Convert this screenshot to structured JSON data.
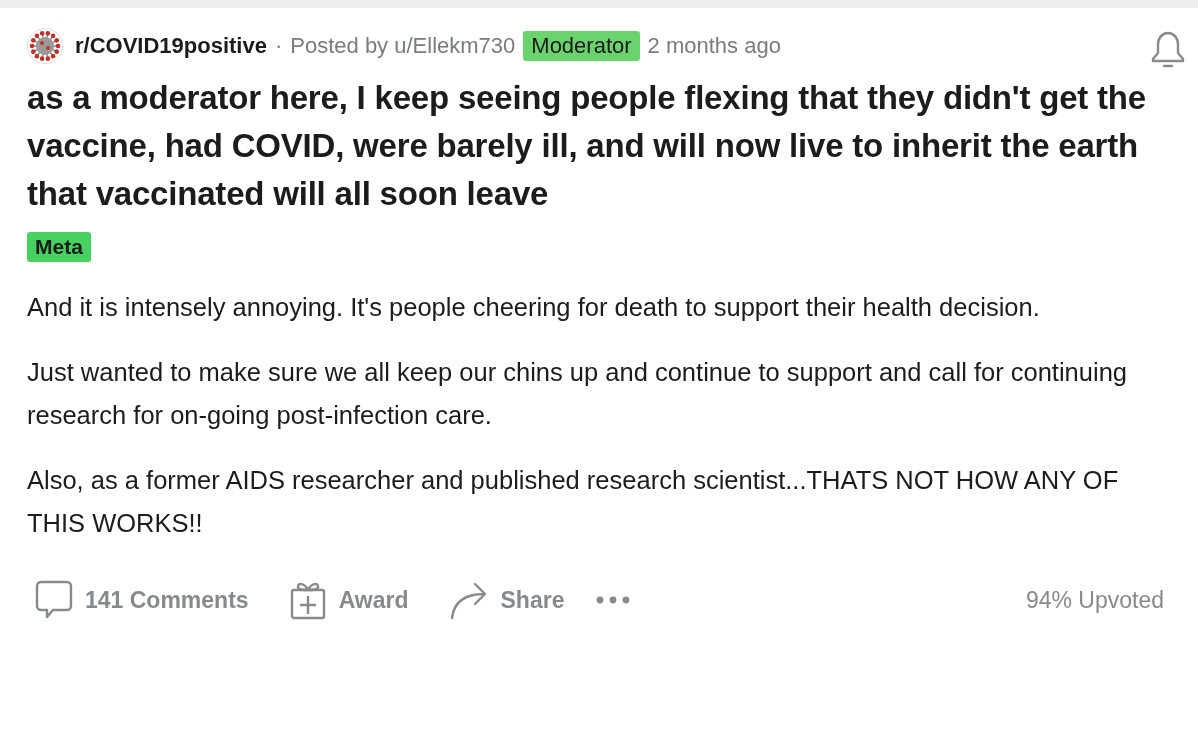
{
  "post": {
    "subreddit": "r/COVID19positive",
    "separator": "·",
    "posted_by": "Posted by u/Ellekm730",
    "user_flair": "Moderator",
    "time": "2 months ago",
    "title": "as a moderator here, I keep seeing people flexing that they didn't get the vaccine, had COVID, were barely ill, and will now live to inherit the earth that vaccinated will all soon leave",
    "post_flair": "Meta",
    "body": [
      "And it is intensely annoying. It's people cheering for death to support their health decision.",
      "Just wanted to make sure we all keep our chins up and continue to support and call for continuing research for on-going post-infection care.",
      "Also, as a former AIDS researcher and published research scientist...THATS NOT HOW ANY OF THIS WORKS!!"
    ],
    "actions": [
      {
        "kind": "comments",
        "label": "141 Comments"
      },
      {
        "kind": "award",
        "label": "Award"
      },
      {
        "kind": "share",
        "label": "Share"
      },
      {
        "kind": "more"
      }
    ],
    "upvote_ratio": "94% Upvoted"
  }
}
